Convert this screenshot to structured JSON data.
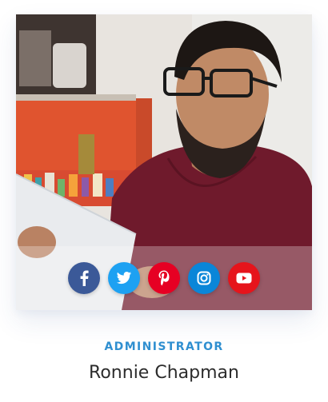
{
  "profile": {
    "role": "ADMINISTRATOR",
    "name": "Ronnie Chapman",
    "photo_subject": "bearded man with glasses reading a paper"
  },
  "social": [
    {
      "network": "facebook",
      "icon": "facebook-icon",
      "color": "#3b5998"
    },
    {
      "network": "twitter",
      "icon": "twitter-icon",
      "color": "#1da1f2"
    },
    {
      "network": "pinterest",
      "icon": "pinterest-icon",
      "color": "#e60023"
    },
    {
      "network": "instagram",
      "icon": "instagram-icon",
      "color": "#0a86d8"
    },
    {
      "network": "youtube",
      "icon": "youtube-icon",
      "color": "#e6141b"
    }
  ],
  "colors": {
    "role_accent": "#2f8fd0",
    "name_text": "#2c2c2c"
  }
}
